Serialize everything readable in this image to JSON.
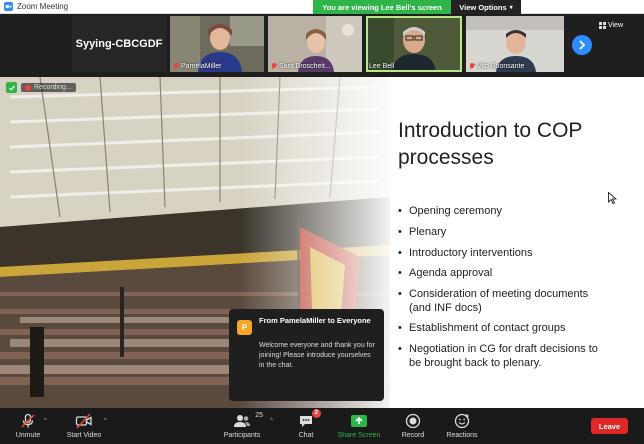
{
  "window": {
    "title": "Zoom Meeting"
  },
  "banner": {
    "message": "You are viewing Lee Bell's screen",
    "options_label": "View Options"
  },
  "participants_strip": {
    "name_only_tile": "Syying-CBCGDF",
    "tiles": [
      {
        "name": "PamelaMiller",
        "muted": true
      },
      {
        "name": "Sara Broscheit...",
        "muted": true
      },
      {
        "name": "Lee Bell",
        "muted": false,
        "active": true
      },
      {
        "name": "Vito Buonsante",
        "muted": true
      }
    ],
    "view_label": "View"
  },
  "recording": {
    "label": "Recording..."
  },
  "slide": {
    "title": "Introduction to COP processes",
    "bullets": [
      "Opening ceremony",
      "Plenary",
      "Introductory interventions",
      "Agenda approval",
      "Consideration of meeting documents (and INF docs)",
      "Establishment of contact groups",
      "Negotiation in CG for draft decisions to be brought back to plenary."
    ]
  },
  "chat_toast": {
    "avatar_letter": "P",
    "from": "From PamelaMiller to Everyone",
    "message": "Welcome everyone and thank you for joining! Please introduce yourselves in the chat."
  },
  "controls": {
    "unmute": "Unmute",
    "start_video": "Start Video",
    "participants": "Participants",
    "participants_count": "25",
    "chat": "Chat",
    "chat_badge": "2",
    "share_screen": "Share Screen",
    "record": "Record",
    "reactions": "Reactions",
    "leave": "Leave"
  },
  "colors": {
    "accent_blue": "#2d8cff",
    "share_green": "#2fb44a",
    "leave_red": "#e02828",
    "muted_red": "#e8453c"
  }
}
